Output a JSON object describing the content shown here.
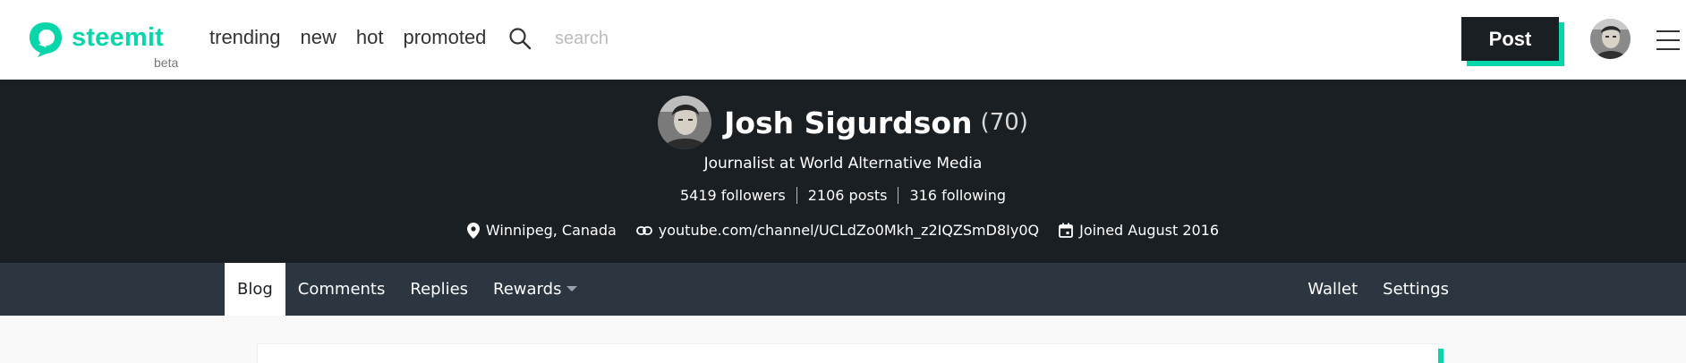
{
  "header": {
    "logo_text": "steemit",
    "logo_badge": "beta",
    "nav": [
      "trending",
      "new",
      "hot",
      "promoted"
    ],
    "search_placeholder": "search",
    "post_label": "Post",
    "brand_color": "#06d6a9"
  },
  "profile": {
    "name": "Josh Sigurdson",
    "reputation": "(70)",
    "about": "Journalist at World Alternative Media",
    "followers": "5419 followers",
    "posts": "2106 posts",
    "following": "316 following",
    "location": "Winnipeg, Canada",
    "website": "youtube.com/channel/UCLdZo0Mkh_z2IQZSmD8Iy0Q",
    "joined": "Joined August 2016"
  },
  "tabs": {
    "left": [
      {
        "label": "Blog",
        "active": true
      },
      {
        "label": "Comments",
        "active": false
      },
      {
        "label": "Replies",
        "active": false
      },
      {
        "label": "Rewards",
        "active": false,
        "dropdown": true
      }
    ],
    "right": [
      {
        "label": "Wallet"
      },
      {
        "label": "Settings"
      }
    ]
  },
  "icons": {
    "search": "search-icon",
    "menu": "hamburger-menu-icon",
    "location": "map-pin-icon",
    "website": "link-icon",
    "joined": "calendar-icon"
  }
}
